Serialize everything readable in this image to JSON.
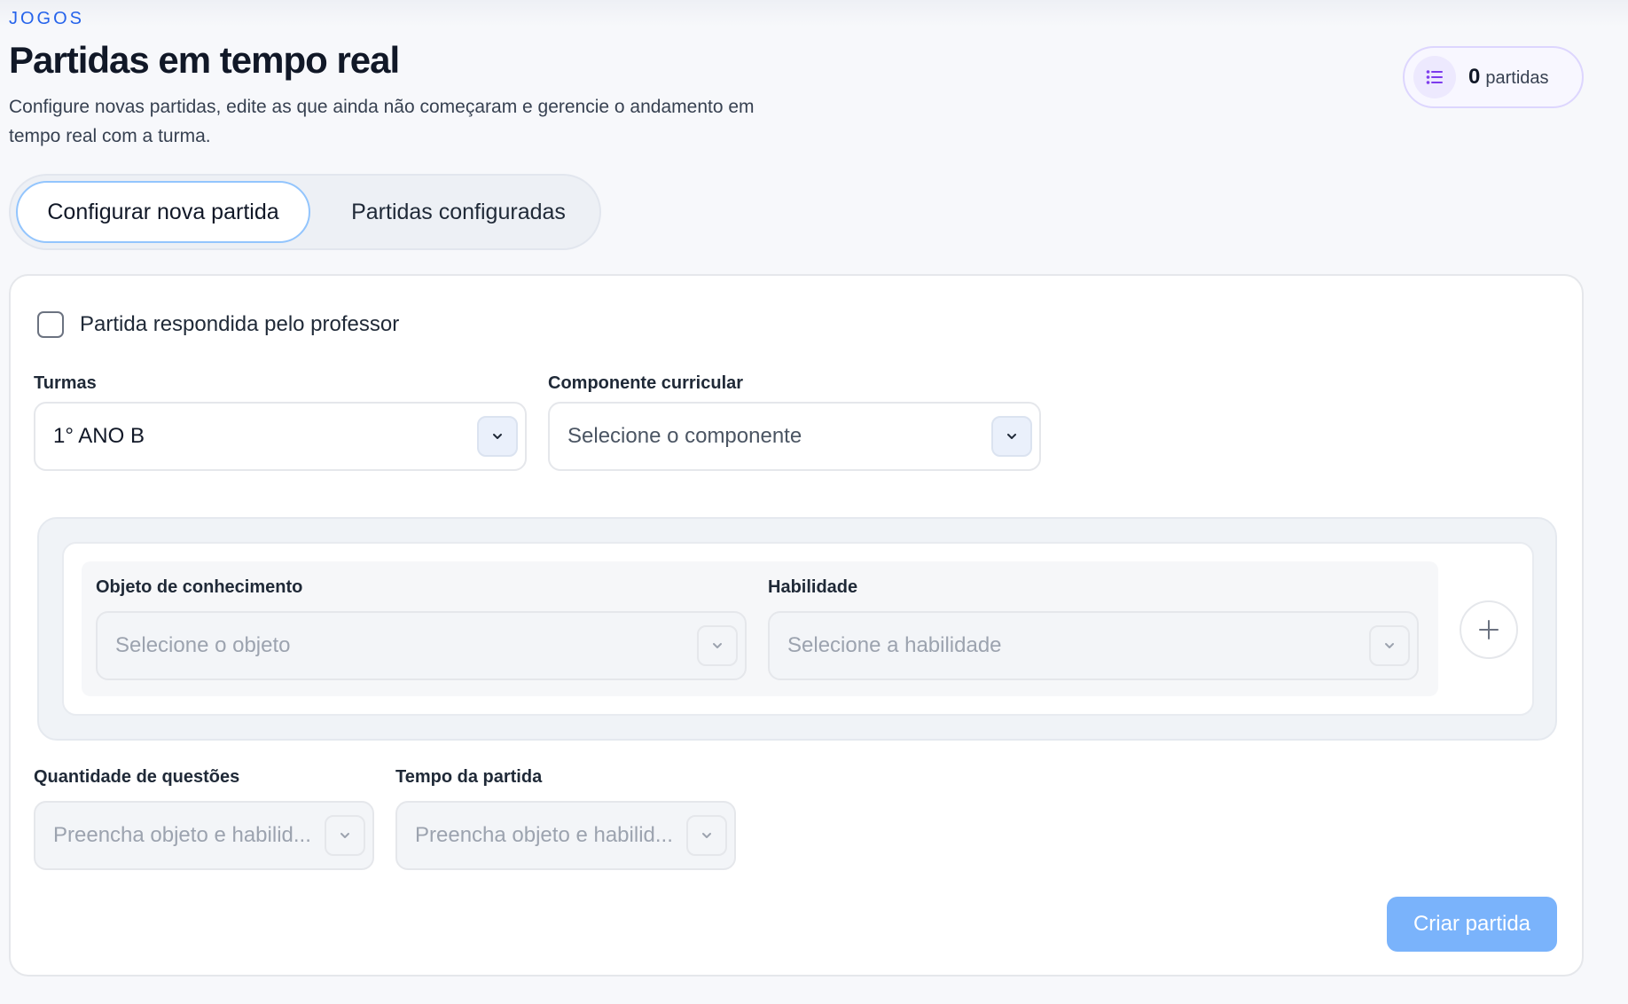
{
  "header": {
    "eyebrow": "JOGOS",
    "title": "Partidas em tempo real",
    "description": "Configure novas partidas, edite as que ainda não começaram e gerencie o andamento em tempo real com a turma.",
    "count_value": "0",
    "count_label": "partidas",
    "count_icon": "list-icon"
  },
  "tabs": [
    {
      "label": "Configurar nova partida",
      "active": true
    },
    {
      "label": "Partidas configuradas",
      "active": false
    }
  ],
  "form": {
    "checkbox_label": "Partida respondida pelo professor",
    "checkbox_checked": false,
    "turmas": {
      "label": "Turmas",
      "value": "1° ANO B"
    },
    "componente": {
      "label": "Componente curricular",
      "placeholder": "Selecione o componente"
    },
    "objeto": {
      "label": "Objeto de conhecimento",
      "placeholder": "Selecione o objeto"
    },
    "habilidade": {
      "label": "Habilidade",
      "placeholder": "Selecione a habilidade"
    },
    "quantidade": {
      "label": "Quantidade de questões",
      "placeholder": "Preencha objeto e habilid..."
    },
    "tempo": {
      "label": "Tempo da partida",
      "placeholder": "Preencha objeto e habilid..."
    },
    "submit_label": "Criar partida"
  },
  "colors": {
    "accent": "#2563eb",
    "tab_active_border": "#93c5fd",
    "submit_bg": "#7ab3fb",
    "count_icon_bg": "#ede9fe"
  }
}
